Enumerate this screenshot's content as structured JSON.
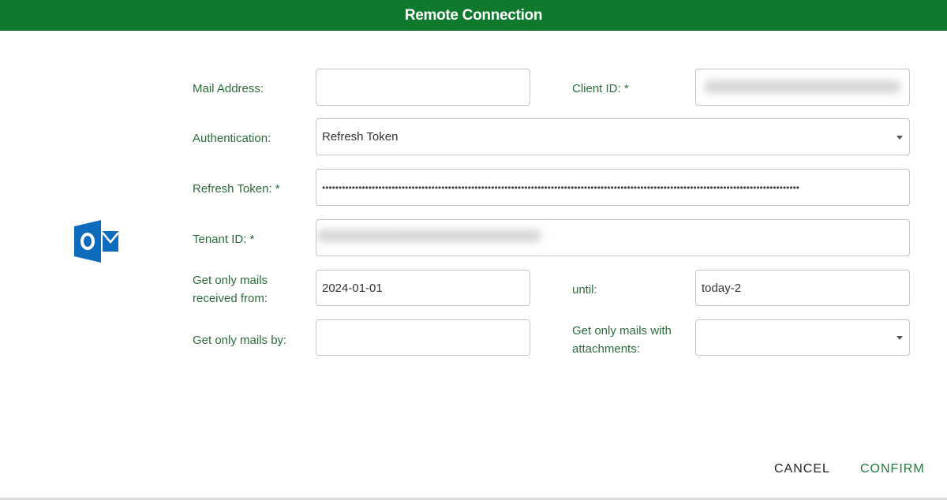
{
  "dialog": {
    "title": "Remote Connection"
  },
  "icon": {
    "name": "outlook-icon",
    "color": "#0f6cbd"
  },
  "form": {
    "mail_address": {
      "label": "Mail Address:",
      "value": ""
    },
    "client_id": {
      "label": "Client ID: *",
      "value": ""
    },
    "authentication": {
      "label": "Authentication:",
      "value": "Refresh Token"
    },
    "refresh_token": {
      "label": "Refresh Token: *",
      "value": "••••••••••••••••••••••••••••••••••••••••••••••••••••••••••••••••••••••••••••••••••••••••••••••••••••••••••••••••••••••••••••••••••••••••••••••••"
    },
    "tenant_id": {
      "label": "Tenant ID: *",
      "value": ""
    },
    "received_from": {
      "label_line1": "Get only mails",
      "label_line2": "received from:",
      "value": "2024-01-01"
    },
    "until": {
      "label": "until:",
      "value": "today-2"
    },
    "mails_by": {
      "label": "Get only mails by:",
      "value": ""
    },
    "with_attachments": {
      "label_line1": "Get only mails with",
      "label_line2": "attachments:",
      "value": ""
    }
  },
  "actions": {
    "cancel_label": "CANCEL",
    "confirm_label": "CONFIRM"
  },
  "colors": {
    "header": "#0f7a2e",
    "label": "#2e6b3c",
    "confirm": "#1f7a3a"
  }
}
